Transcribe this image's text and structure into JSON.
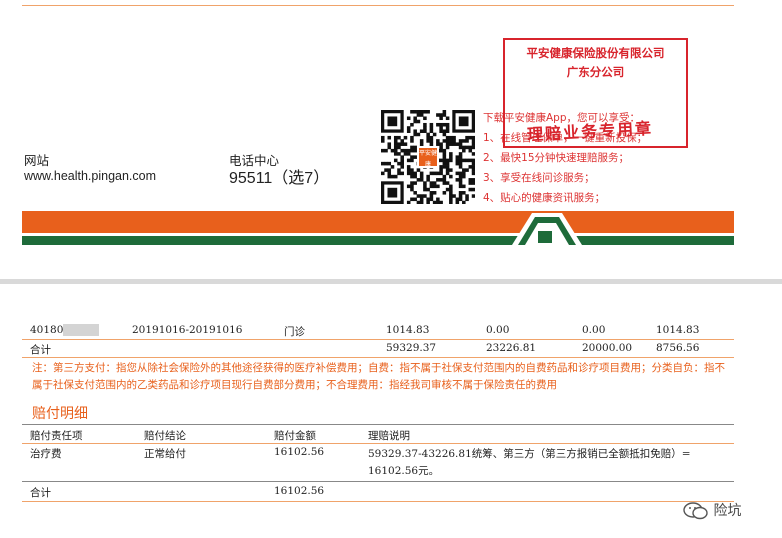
{
  "top_page": {
    "website_label": "网站",
    "website_url": "www.health.pingan.com",
    "phone_label": "电话中心",
    "phone_number": "95511（选7）",
    "qr_logo_text": "平安健康",
    "service_title": "下载平安健康App，您可以享受：",
    "services": [
      "1、在线管理保单，一键重新投保；",
      "2、最快15分钟快速理赔服务；",
      "3、享受在线问诊服务；",
      "4、贴心的健康资讯服务；"
    ],
    "stamp": {
      "company": "平安健康保险股份有限公司",
      "branch": "广东分公司",
      "purpose": "理赔业务专用章"
    },
    "colors": {
      "orange": "#e8601c",
      "green": "#1e6b3a",
      "stamp_red": "#d8242c"
    }
  },
  "expense_table": {
    "row": {
      "id_prefix": "40180",
      "id_suffix": "0",
      "period": "20191016-20191016",
      "type": "门诊",
      "total": "1014.83",
      "col_a": "0.00",
      "col_b": "0.00",
      "col_c": "1014.83"
    },
    "total_row": {
      "label": "合计",
      "total": "59329.37",
      "col_a": "23226.81",
      "col_b": "20000.00",
      "col_c": "8756.56"
    }
  },
  "note_text": "注：第三方支付：指您从除社会保险外的其他途径获得的医疗补偿费用；自费：指不属于社保支付范围内的自费药品和诊疗项目费用；分类自负：指不属于社保支付范围内的乙类药品和诊疗项目现行自费部分费用；不合理费用：指经我司审核不属于保险责任的费用",
  "payout": {
    "section_title": "赔付明细",
    "headers": [
      "赔付责任项",
      "赔付结论",
      "赔付金额",
      "理赔说明"
    ],
    "rows": [
      {
        "item": "治疗费",
        "conclusion": "正常给付",
        "amount": "16102.56",
        "explanation_line1": "59329.37-43226.81统筹、第三方（第三方报销已全额抵扣免赔）=",
        "explanation_line2": "16102.56元。"
      }
    ],
    "total_label": "合计",
    "total_amount": "16102.56"
  },
  "watermark": {
    "text": "险坑",
    "icon": "wechat-icon"
  }
}
